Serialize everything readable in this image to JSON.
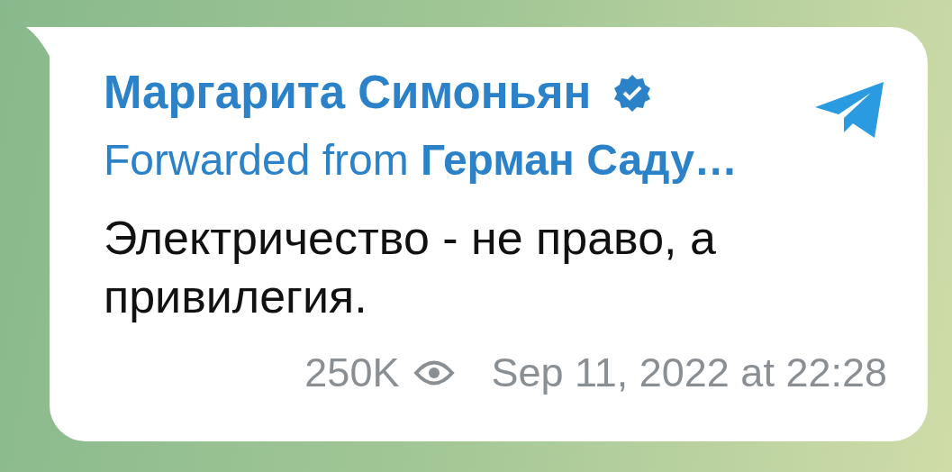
{
  "message": {
    "author": "Маргарита Симоньян",
    "verified": true,
    "forwarded": "Forwarded from **Герман Саду…**",
    "text": "Электричество - не право, а привилегия.",
    "views": "250K",
    "date": "Sep 11, 2022 at 22:28"
  }
}
